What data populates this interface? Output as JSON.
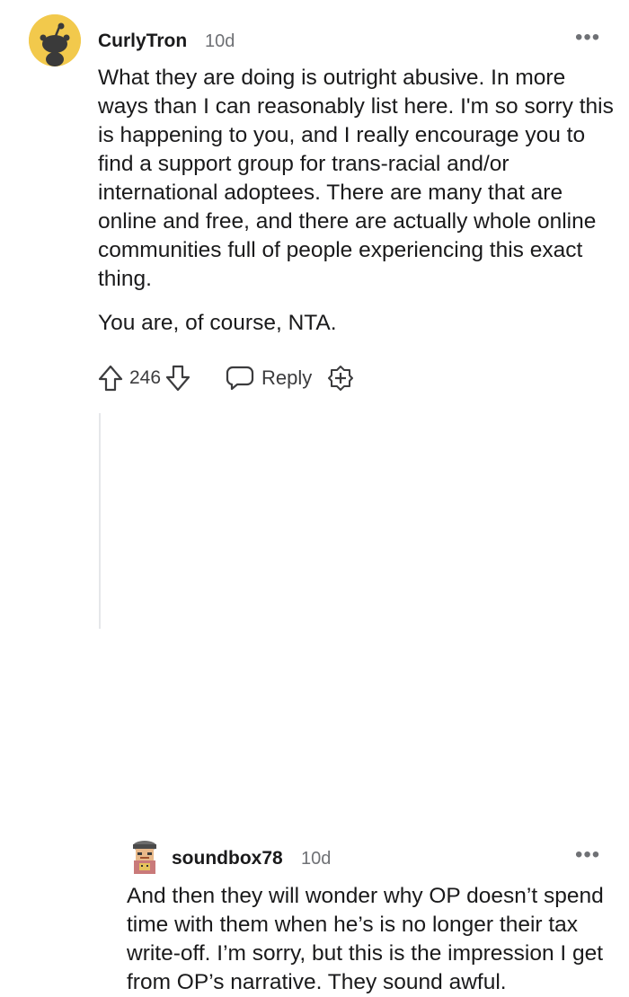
{
  "comment": {
    "username": "CurlyTron",
    "age": "10d",
    "more_label": "•••",
    "paragraphs": [
      "What they are doing is outright abusive. In more ways than I can reasonably list here. I'm so sorry this is happening to you, and I really encourage you to find a support group for trans-racial and/or international adoptees. There are many that are online and free, and there are actually whole online communities full of people experiencing this exact thing.",
      "You are, of course, NTA."
    ],
    "votes": "246",
    "reply_label": "Reply",
    "avatar_bg": "#f2c94c"
  },
  "reply": {
    "username": "soundbox78",
    "age": "10d",
    "more_label": "•••",
    "text": "And then they will wonder why OP doesn’t spend time with them when he’s is no longer their tax write-off. I’m sorry, but this is the impression I get from OP’s narrative. They sound awful."
  },
  "icons": {
    "upvote": "arrow-up-outline",
    "downvote": "arrow-down-outline",
    "reply": "speech-bubble",
    "award": "award-plus"
  }
}
